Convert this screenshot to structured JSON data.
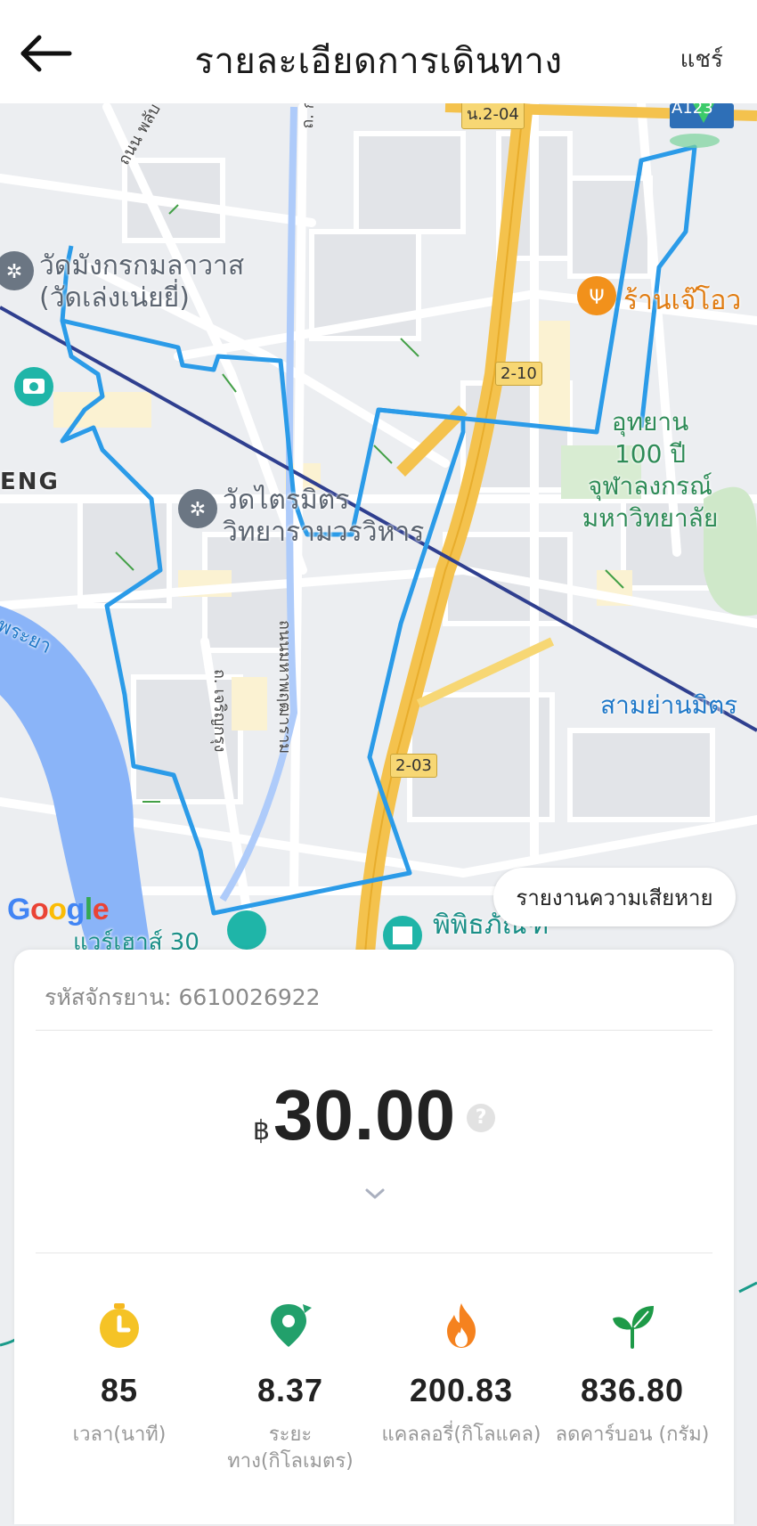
{
  "header": {
    "title": "รายละเอียดการเดินทาง",
    "share_label": "แชร์"
  },
  "map": {
    "labels": {
      "temple1": "วัดมังกรกมลาวาส\n(วัดเล่งเน่ยยี่)",
      "temple2": "วัดไตรมิตร\nวิทยารามวรวิหาร",
      "restaurant": "ร้านเจ๊โอว",
      "park": "อุทยาน\n100 ปี\nจุฬาลงกรณ์\nมหาวิทยาลัย",
      "samyan": "สามย่านมิตร",
      "district": "ENG",
      "museum": "พิพิธภัณฑ์",
      "warehouse": "แวร์เฮาส์ 30",
      "road1": "ถนน พลับ",
      "road2": "ถ. กรุงเกษม",
      "road3": "ถนนมหาพฤฒาราม",
      "road4": "ถ. เจริญกรุง",
      "river": "พระยา",
      "shield1": "2-10",
      "shield2": "2-03",
      "shield3": "น.2-04",
      "station": "A123"
    },
    "google_logo": "Google",
    "report_damage_label": "รายงานความเสียหาย"
  },
  "card": {
    "bike_code_label": "รหัสจักรยาน: 6610026922",
    "currency": "฿",
    "price": "30.00",
    "help": "?",
    "stats": [
      {
        "icon": "timer-icon",
        "value": "85",
        "label": "เวลา(นาที)"
      },
      {
        "icon": "location-pin-icon",
        "value": "8.37",
        "label": "ระยะ\nทาง(กิโลเมตร)"
      },
      {
        "icon": "flame-icon",
        "value": "200.83",
        "label": "แคลลอรี่(กิโลแคล)"
      },
      {
        "icon": "leaf-icon",
        "value": "836.80",
        "label": "ลดคาร์บอน (กรัม)"
      }
    ]
  },
  "colors": {
    "route": "#2b9be8",
    "expressway": "#f4c24d",
    "rail_line": "#2f3f8f",
    "river": "#8ab4f8",
    "park": "#cfe8c9"
  }
}
